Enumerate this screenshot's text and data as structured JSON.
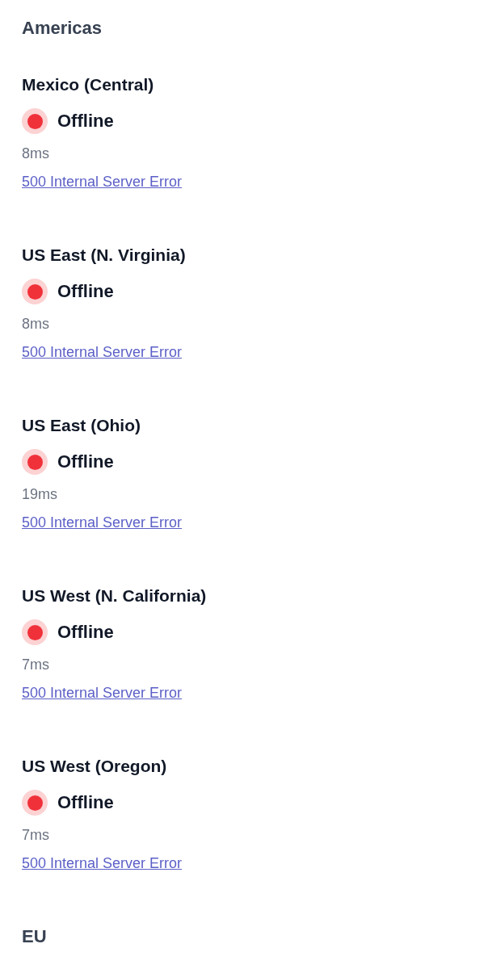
{
  "sections": [
    {
      "title": "Americas",
      "regions": [
        {
          "name": "Mexico (Central)",
          "status": {
            "kind": "offline",
            "label": "Offline"
          },
          "latency": "8ms",
          "error": "500 Internal Server Error"
        },
        {
          "name": "US East (N. Virginia)",
          "status": {
            "kind": "offline",
            "label": "Offline"
          },
          "latency": "8ms",
          "error": "500 Internal Server Error"
        },
        {
          "name": "US East (Ohio)",
          "status": {
            "kind": "offline",
            "label": "Offline"
          },
          "latency": "19ms",
          "error": "500 Internal Server Error"
        },
        {
          "name": "US West (N. California)",
          "status": {
            "kind": "offline",
            "label": "Offline"
          },
          "latency": "7ms",
          "error": "500 Internal Server Error"
        },
        {
          "name": "US West (Oregon)",
          "status": {
            "kind": "offline",
            "label": "Offline"
          },
          "latency": "7ms",
          "error": "500 Internal Server Error"
        }
      ]
    },
    {
      "title": "EU"
    }
  ]
}
